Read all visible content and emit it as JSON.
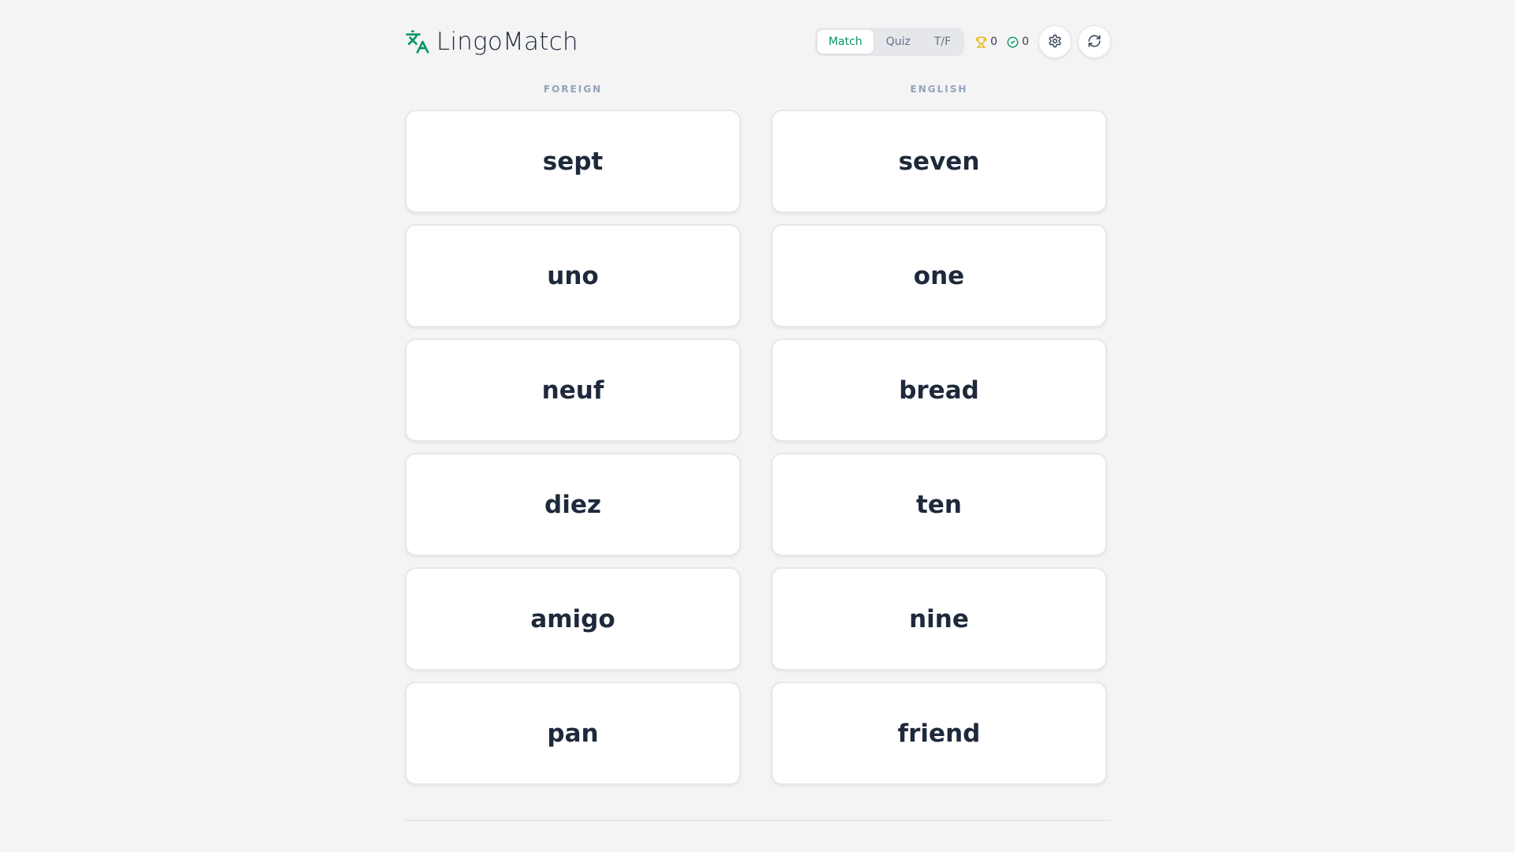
{
  "app": {
    "name": "LingoMatch",
    "brand_color": "#059669"
  },
  "header": {
    "modes": [
      {
        "label": "Match",
        "active": true
      },
      {
        "label": "Quiz",
        "active": false
      },
      {
        "label": "T/F",
        "active": false
      }
    ],
    "stats": {
      "trophy": {
        "icon": "trophy-icon",
        "value": "0",
        "color": "#eab308"
      },
      "correct": {
        "icon": "check-circle-icon",
        "value": "0",
        "color": "#059669"
      }
    },
    "buttons": [
      {
        "icon": "gear-icon"
      },
      {
        "icon": "refresh-icon"
      }
    ]
  },
  "columns": {
    "foreign": {
      "label": "FOREIGN",
      "words": [
        "sept",
        "uno",
        "neuf",
        "diez",
        "amigo",
        "pan"
      ]
    },
    "english": {
      "label": "ENGLISH",
      "words": [
        "seven",
        "one",
        "bread",
        "ten",
        "nine",
        "friend"
      ]
    }
  }
}
